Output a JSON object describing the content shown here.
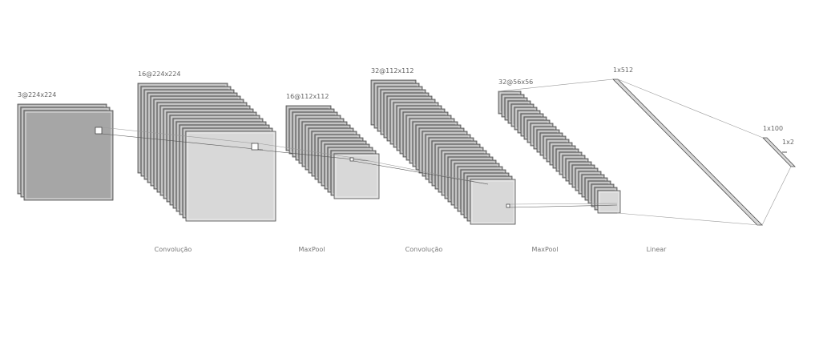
{
  "diagram": {
    "layers": [
      {
        "dim_label": "3@224x224"
      },
      {
        "dim_label": "16@224x224"
      },
      {
        "dim_label": "16@112x112"
      },
      {
        "dim_label": "32@112x112"
      },
      {
        "dim_label": "32@56x56"
      },
      {
        "dim_label": "1x512"
      },
      {
        "dim_label": "1x100"
      },
      {
        "dim_label": "1x2"
      }
    ],
    "operations": [
      {
        "label": "Convolução"
      },
      {
        "label": "MaxPool"
      },
      {
        "label": "Convolução"
      },
      {
        "label": "MaxPool"
      },
      {
        "label": "Linear"
      }
    ],
    "colors": {
      "input_fill": "#a6a6a6",
      "feature_map_fill": "#d8d8d8",
      "edge": "#4d4d4d",
      "connection": "#9a9a9a"
    }
  }
}
